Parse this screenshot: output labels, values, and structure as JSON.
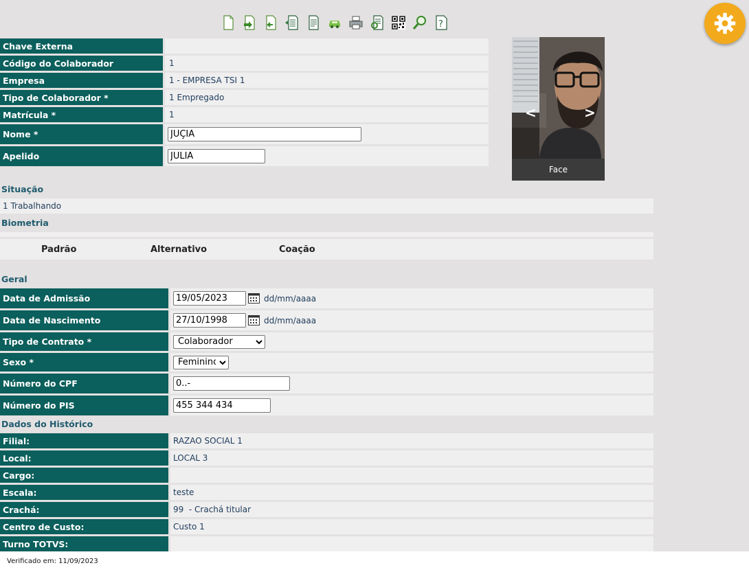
{
  "toolbar": {
    "icons": [
      "new-document-icon",
      "export-icon",
      "undo-icon",
      "list-icon",
      "report-icon",
      "car-icon",
      "print-icon",
      "search-document-icon",
      "qr-code-icon",
      "search-icon",
      "help-icon"
    ]
  },
  "top_fields": [
    {
      "label": "Chave Externa",
      "value": ""
    },
    {
      "label": "Código do Colaborador",
      "value": "1"
    },
    {
      "label": "Empresa",
      "value": "1 - EMPRESA TSI 1"
    },
    {
      "label": "Tipo de Colaborador *",
      "value": "1 Empregado"
    },
    {
      "label": "Matrícula *",
      "value": "1"
    }
  ],
  "nome": {
    "label": "Nome *",
    "value": "JÚÇIA"
  },
  "apelido": {
    "label": "Apelido",
    "value": "JÚLIA"
  },
  "photo": {
    "caption": "Face",
    "prev": "<",
    "next": ">"
  },
  "situacao": {
    "title": "Situação",
    "value": "1 Trabalhando"
  },
  "biometria": {
    "title": "Biometria",
    "columns": [
      "Padrão",
      "Alternativo",
      "Coação"
    ]
  },
  "geral": {
    "title": "Geral",
    "admissao": {
      "label": "Data de Admissão",
      "value": "19/05/2023",
      "format": "dd/mm/aaaa"
    },
    "nascimento": {
      "label": "Data de Nascimento",
      "value": "27/10/1998",
      "format": "dd/mm/aaaa"
    },
    "contrato": {
      "label": "Tipo de Contrato *",
      "value": "Colaborador"
    },
    "sexo": {
      "label": "Sexo *",
      "value": "Feminino"
    },
    "cpf": {
      "label": "Número do CPF",
      "value": "0..-"
    },
    "pis": {
      "label": "Número do PIS",
      "value": "455 344 434"
    }
  },
  "historico": {
    "title": "Dados do Histórico",
    "rows": [
      {
        "label": "Filial:",
        "value": "RAZAO SOCIAL 1"
      },
      {
        "label": "Local:",
        "value": "LOCAL 3"
      },
      {
        "label": "Cargo:",
        "value": ""
      },
      {
        "label": "Escala:",
        "value": "teste"
      },
      {
        "label": "Crachá:",
        "value": "99  - Crachá titular"
      },
      {
        "label": "Centro de Custo:",
        "value": "Custo 1"
      },
      {
        "label": "Turno TOTVS:",
        "value": ""
      }
    ]
  },
  "footer": {
    "text": "Verificado em: 11/09/2023"
  },
  "colors": {
    "label_bg": "#0b5f5c",
    "value_bg": "#f0efef",
    "page_bg": "#e3e1e1",
    "gear": "#f2a91b"
  }
}
